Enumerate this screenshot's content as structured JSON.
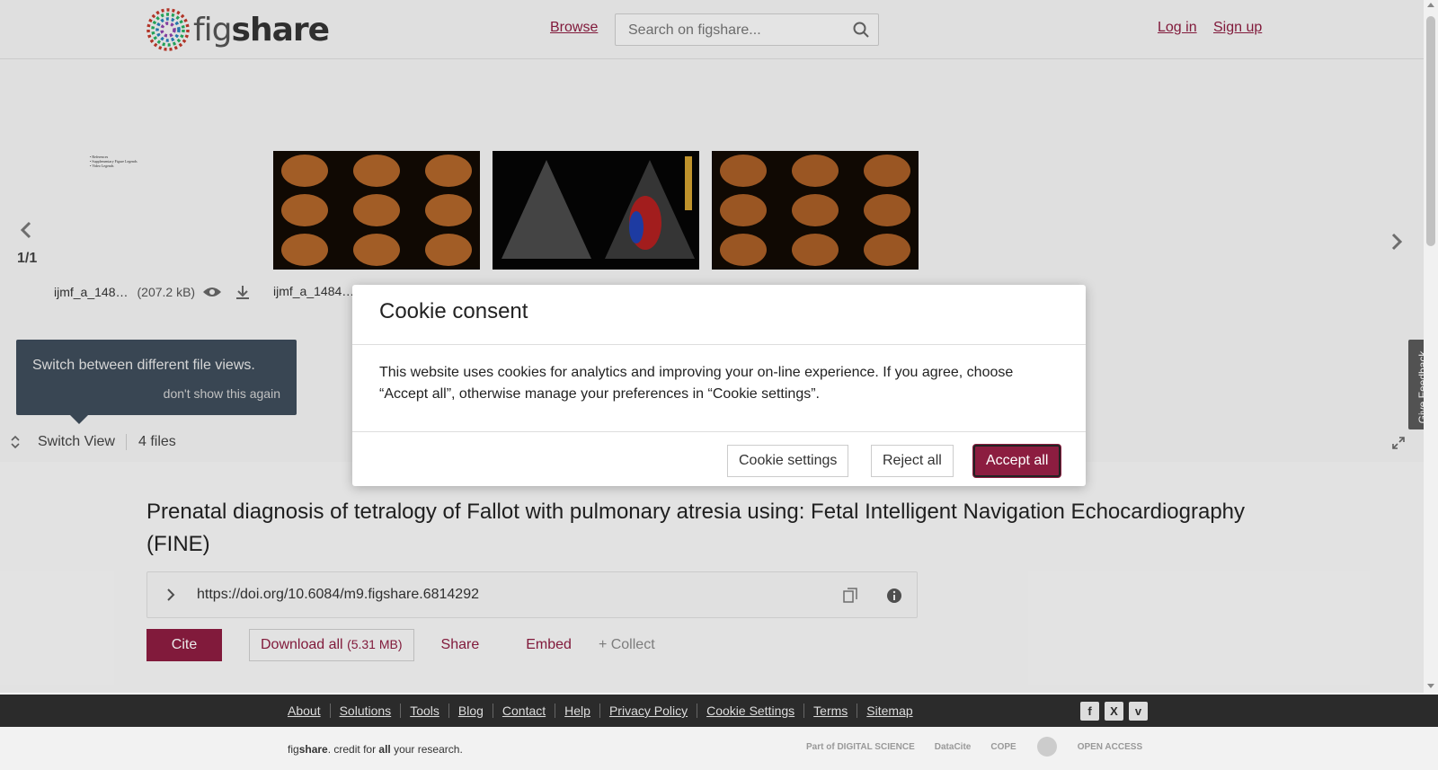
{
  "header": {
    "logo_text_a": "fig",
    "logo_text_b": "share",
    "browse": "Browse",
    "search_placeholder": "Search on figshare...",
    "login": "Log in",
    "signup": "Sign up"
  },
  "viewer": {
    "page_count": "1/1",
    "files": [
      {
        "name": "ijmf_a_148…",
        "size": "(207.2 kB)",
        "doc_lines": [
          "• References",
          "• Supplementary Figure Legends",
          "• Video Legends"
        ]
      },
      {
        "name": "ijmf_a_1484…"
      },
      {
        "name": ""
      },
      {
        "name": ""
      }
    ],
    "tooltip_text": "Switch between different file views.",
    "tooltip_dismiss": "don't show this again",
    "switch_view": "Switch View",
    "files_count": "4 files",
    "feedback": "Give Feedback"
  },
  "item": {
    "title": "Prenatal diagnosis of tetralogy of Fallot with pulmonary atresia using: Fetal Intelligent Navigation Echocardiography (FINE)",
    "doi": "https://doi.org/10.6084/m9.figshare.6814292",
    "cite": "Cite",
    "download_all": "Download all",
    "download_size": "(5.31 MB)",
    "share": "Share",
    "embed": "Embed",
    "collect": "+ Collect"
  },
  "footer": {
    "links": [
      "About",
      "Solutions",
      "Tools",
      "Blog",
      "Contact",
      "Help",
      "Privacy Policy",
      "Cookie Settings",
      "Terms",
      "Sitemap"
    ],
    "social": [
      "f",
      "X",
      "v"
    ],
    "tagline_a": "fig",
    "tagline_b": "share",
    "tagline_c": ". credit for ",
    "tagline_d": "all",
    "tagline_e": " your research.",
    "partners": [
      "Part of DIGITAL SCIENCE",
      "DataCite",
      "COPE",
      "",
      "OPEN ACCESS"
    ]
  },
  "cookie": {
    "title": "Cookie consent",
    "body": "This website uses cookies for analytics and improving your on-line experience. If you agree, choose “Accept all”, otherwise manage your preferences in “Cookie settings”.",
    "settings": "Cookie settings",
    "reject": "Reject all",
    "accept": "Accept all"
  },
  "colors": {
    "brand": "#8c1d40",
    "footer_bg": "#2b2b2b"
  }
}
